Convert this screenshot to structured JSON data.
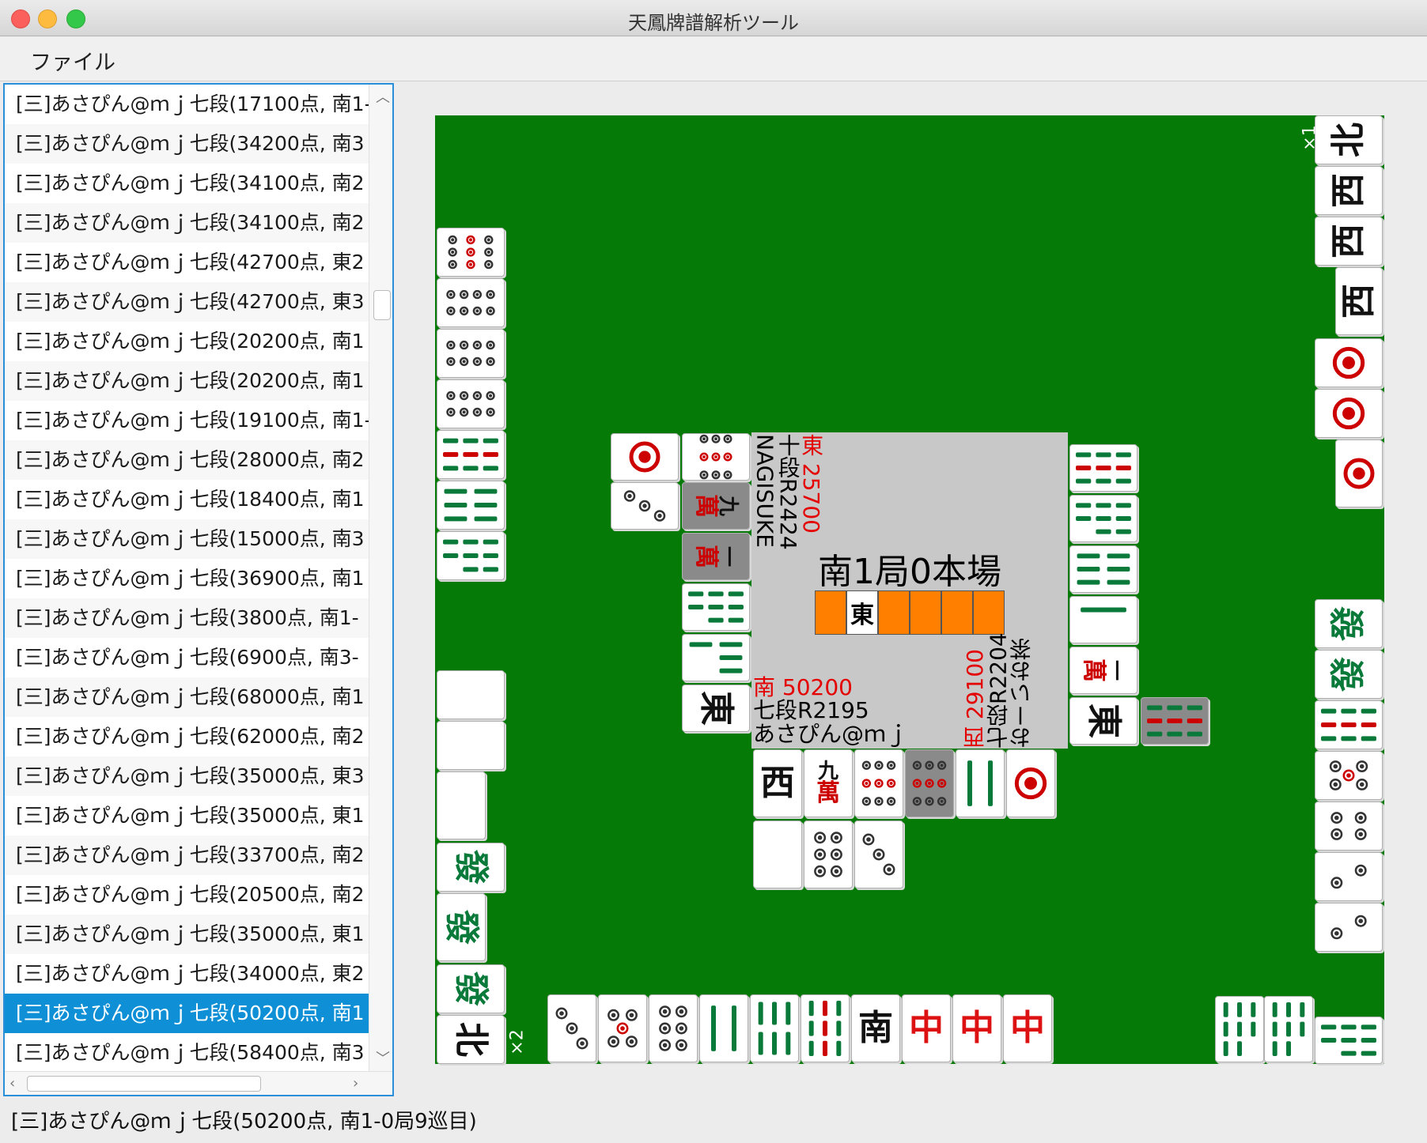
{
  "window": {
    "title": "天鳳牌譜解析ツール"
  },
  "menu": {
    "file": "ファイル"
  },
  "game_list": [
    "[三]あさぴん@ｍｊ七段(17100点, 南1-",
    "[三]あさぴん@ｍｊ七段(34200点, 南3",
    "[三]あさぴん@ｍｊ七段(34100点, 南2",
    "[三]あさぴん@ｍｊ七段(34100点, 南2",
    "[三]あさぴん@ｍｊ七段(42700点, 東2",
    "[三]あさぴん@ｍｊ七段(42700点, 東3",
    "[三]あさぴん@ｍｊ七段(20200点, 南1",
    "[三]あさぴん@ｍｊ七段(20200点, 南1",
    "[三]あさぴん@ｍｊ七段(19100点, 南1-",
    "[三]あさぴん@ｍｊ七段(28000点, 南2",
    "[三]あさぴん@ｍｊ七段(18400点, 南1",
    "[三]あさぴん@ｍｊ七段(15000点, 南3",
    "[三]あさぴん@ｍｊ七段(36900点, 南1",
    "[三]あさぴん@ｍｊ七段(3800点, 南1-",
    "[三]あさぴん@ｍｊ七段(6900点, 南3-",
    "[三]あさぴん@ｍｊ七段(68000点, 南1",
    "[三]あさぴん@ｍｊ七段(62000点, 南2",
    "[三]あさぴん@ｍｊ七段(35000点, 東3",
    "[三]あさぴん@ｍｊ七段(35000点, 東1",
    "[三]あさぴん@ｍｊ七段(33700点, 南2",
    "[三]あさぴん@ｍｊ七段(20500点, 南2",
    "[三]あさぴん@ｍｊ七段(35000点, 東1",
    "[三]あさぴん@ｍｊ七段(34000点, 東2",
    "[三]あさぴん@ｍｊ七段(50200点, 南1",
    "[三]あさぴん@ｍｊ七段(58400点, 南3"
  ],
  "selected_index": 23,
  "status": "[三]あさぴん@ｍｊ七段(50200点, 南1-0局9巡目)",
  "board": {
    "round": "南1局0本場",
    "dora_indicator": "東",
    "players": {
      "top": {
        "wind": "東",
        "score": "25700",
        "rank": "十段R2424",
        "name": "NAGISUKE"
      },
      "bottom": {
        "wind": "南",
        "score": "50200",
        "rank": "七段R2195",
        "name": "あさぴん@ｍｊ"
      },
      "right": {
        "wind": "西",
        "score": "29100",
        "rank": "七段R2204",
        "name": "おーいお茶"
      }
    },
    "counts": {
      "right_nuki": "×1",
      "bottom_nuki": "×2"
    },
    "tiles": {
      "nine": "九",
      "man": "萬",
      "one": "一",
      "west": "西",
      "east": "東",
      "south": "南",
      "north": "北",
      "red_dragon": "中",
      "green_dragon": "發"
    }
  },
  "colors": {
    "table": "#067a06",
    "center": "#c8c8c8",
    "marker": "#ff7f00",
    "selection": "#0f8fd5"
  }
}
